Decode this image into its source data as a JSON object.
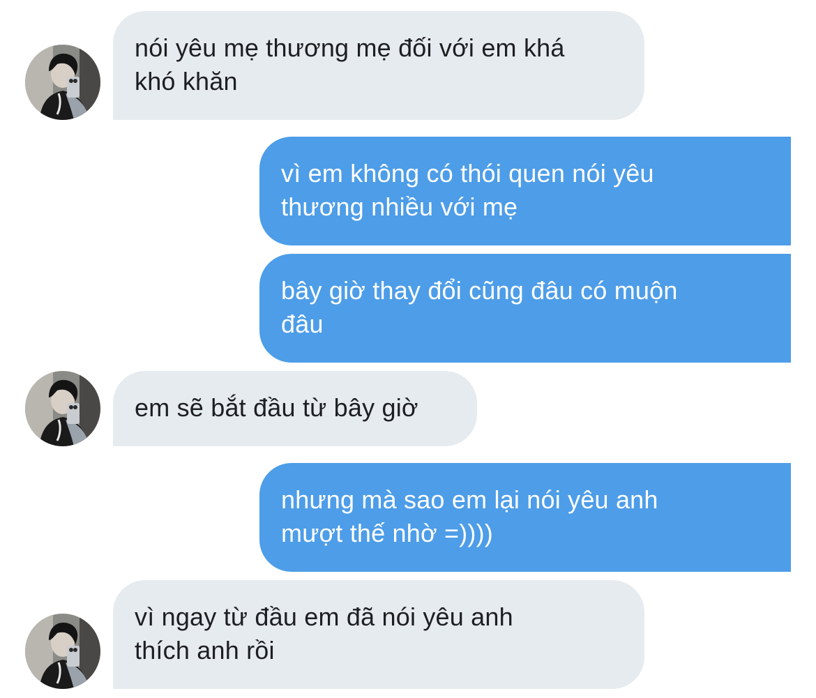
{
  "messages": [
    {
      "sender": "them",
      "text": "nói yêu mẹ thương mẹ đối với em khá\nkhó khăn"
    },
    {
      "sender": "me",
      "text": "vì em không có thói quen nói yêu\nthương nhiều với mẹ"
    },
    {
      "sender": "me",
      "text": "bây giờ thay đổi cũng đâu có muộn\nđâu"
    },
    {
      "sender": "them",
      "text": "em sẽ bắt đầu từ bây giờ"
    },
    {
      "sender": "me",
      "text": "nhưng mà sao em lại nói yêu anh\nmượt thế nhờ =))))"
    },
    {
      "sender": "them",
      "text": "vì ngay từ đầu em đã nói yêu anh\nthích anh rồi"
    }
  ],
  "colors": {
    "incoming_bubble": "#e6ebef",
    "outgoing_bubble": "#4d9de8",
    "incoming_text": "#1d1f22",
    "outgoing_text": "#ffffff"
  },
  "avatar_icon": "profile-photo-icon"
}
